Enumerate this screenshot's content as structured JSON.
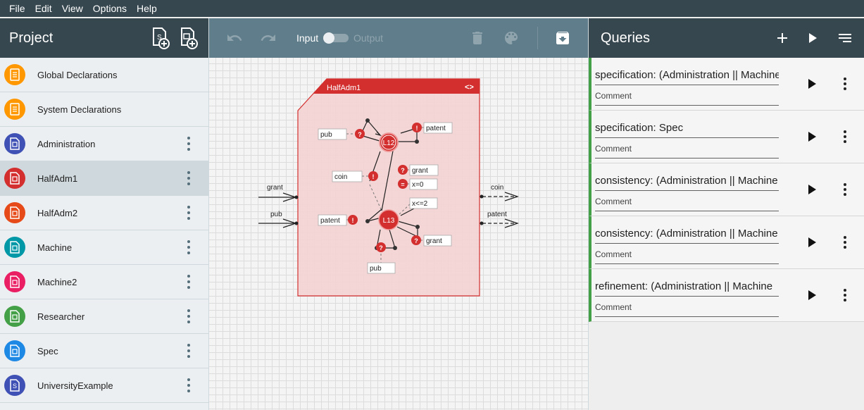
{
  "menu": [
    "File",
    "Edit",
    "View",
    "Options",
    "Help"
  ],
  "project": {
    "title": "Project",
    "items": [
      {
        "label": "Global Declarations",
        "icon": "document-icon",
        "color": "#ff9800",
        "has_menu": false
      },
      {
        "label": "System Declarations",
        "icon": "document-icon",
        "color": "#ff9800",
        "has_menu": false
      },
      {
        "label": "Administration",
        "icon": "component-icon",
        "color": "#3f51b5",
        "has_menu": true
      },
      {
        "label": "HalfAdm1",
        "icon": "component-icon",
        "color": "#d32f2f",
        "has_menu": true,
        "selected": true
      },
      {
        "label": "HalfAdm2",
        "icon": "component-icon",
        "color": "#e64a19",
        "has_menu": true
      },
      {
        "label": "Machine",
        "icon": "component-icon",
        "color": "#0097a7",
        "has_menu": true
      },
      {
        "label": "Machine2",
        "icon": "component-icon",
        "color": "#e91e63",
        "has_menu": true
      },
      {
        "label": "Researcher",
        "icon": "component-icon",
        "color": "#43a047",
        "has_menu": true
      },
      {
        "label": "Spec",
        "icon": "component-icon",
        "color": "#1e88e5",
        "has_menu": true
      },
      {
        "label": "UniversityExample",
        "icon": "system-icon",
        "color": "#3f51b5",
        "has_menu": true
      }
    ]
  },
  "toolbar": {
    "input_label": "Input",
    "output_label": "Output"
  },
  "component": {
    "name": "HalfAdm1",
    "color": "#d32f2f",
    "locations": [
      "L12",
      "L13"
    ],
    "inputs": [
      "grant",
      "pub"
    ],
    "outputs": [
      "coin",
      "patent"
    ],
    "edge_labels": {
      "pub_top": "pub",
      "patent_top": "patent",
      "coin_mid": "coin",
      "grant_mid": "grant",
      "x_reset": "x=0",
      "x_guard": "x<=2",
      "patent_left": "patent",
      "grant_right": "grant",
      "pub_bottom": "pub"
    },
    "nail_symbols": {
      "input": "?",
      "output": "!",
      "update": "="
    }
  },
  "queries": {
    "title": "Queries",
    "items": [
      {
        "text": "specification: (Administration || Machine",
        "comment": "Comment"
      },
      {
        "text": "specification: Spec",
        "comment": "Comment"
      },
      {
        "text": "consistency: (Administration || Machine",
        "comment": "Comment"
      },
      {
        "text": "consistency: (Administration || Machine",
        "comment": "Comment"
      },
      {
        "text": "refinement: (Administration || Machine",
        "comment": "Comment"
      }
    ]
  }
}
